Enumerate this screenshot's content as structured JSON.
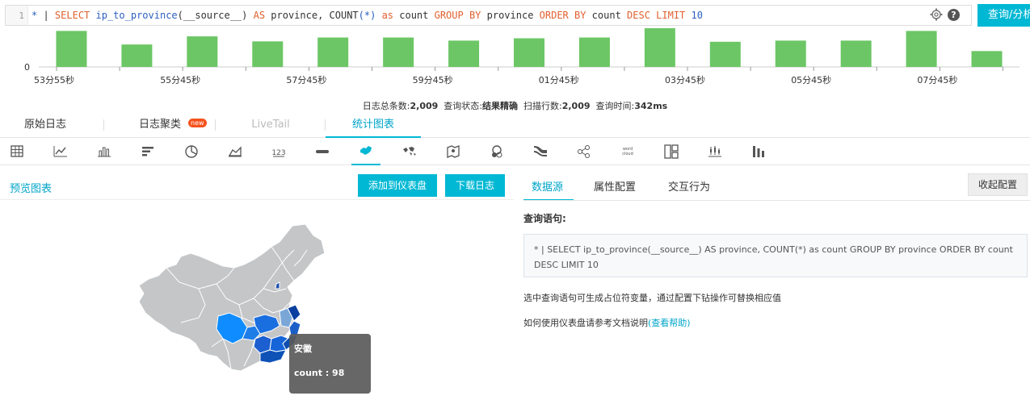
{
  "query": {
    "line_number": "1",
    "tokens": [
      {
        "t": "*",
        "c": "tk-star"
      },
      {
        "t": " | ",
        "c": "tk-punc"
      },
      {
        "t": "SELECT",
        "c": "tk-kw"
      },
      {
        "t": " ip_to_province",
        "c": "tk-blue"
      },
      {
        "t": "(",
        "c": "tk-punc"
      },
      {
        "t": "__source__",
        "c": "tk-id"
      },
      {
        "t": ")",
        "c": "tk-punc"
      },
      {
        "t": " AS",
        "c": "tk-kw"
      },
      {
        "t": " province, COUNT",
        "c": "tk-id"
      },
      {
        "t": "(*)",
        "c": "tk-blue"
      },
      {
        "t": " as",
        "c": "tk-kw"
      },
      {
        "t": " count ",
        "c": "tk-id"
      },
      {
        "t": "GROUP BY",
        "c": "tk-kw"
      },
      {
        "t": " province ",
        "c": "tk-id"
      },
      {
        "t": "ORDER BY",
        "c": "tk-kw"
      },
      {
        "t": " count ",
        "c": "tk-id"
      },
      {
        "t": "DESC LIMIT",
        "c": "tk-kw"
      },
      {
        "t": " 10",
        "c": "tk-blue"
      }
    ],
    "search_button": "查询/分析"
  },
  "histogram": {
    "y_zero_label": "0",
    "bar_color": "#6cc665",
    "time_labels": [
      "53分55秒",
      "55分45秒",
      "57分45秒",
      "59分45秒",
      "01分45秒",
      "03分45秒",
      "05分45秒",
      "07分45秒"
    ],
    "bars": [
      0.93,
      0.58,
      0.79,
      0.66,
      0.76,
      0.76,
      0.68,
      0.74,
      0.76,
      1.0,
      0.65,
      0.68,
      0.68,
      0.93,
      0.41
    ]
  },
  "stats": {
    "total_label": "日志总条数:",
    "total_value": "2,009",
    "status_label": "查询状态:",
    "status_value": "结果精确",
    "scanned_label": "扫描行数:",
    "scanned_value": "2,009",
    "time_label": "查询时间:",
    "time_value": "342ms"
  },
  "main_tabs": {
    "raw_logs": "原始日志",
    "log_cluster": "日志聚类",
    "new_badge": "new",
    "livetail": "LiveTail",
    "charts": "统计图表"
  },
  "chart_types": [
    "table",
    "line",
    "bar",
    "horizontal-bar",
    "pie",
    "area",
    "single-value",
    "progress-bar",
    "map",
    "world-map",
    "amap",
    "flow",
    "sankey",
    "force",
    "word-cloud",
    "matrix-tree",
    "candlestick",
    "column"
  ],
  "active_chart_type": "map",
  "preview": {
    "title": "预览图表",
    "add_dashboard": "添加到仪表盘",
    "download_logs": "下载日志"
  },
  "map": {
    "tooltip_province": "安徽",
    "tooltip_count": "count : 98",
    "base_color": "#c4c6c8",
    "scale_colors": [
      "#00a2ff",
      "#1a6fe0",
      "#0a3f9f",
      "#7aa7d8"
    ]
  },
  "right_panel": {
    "tabs": [
      "数据源",
      "属性配置",
      "交互行为"
    ],
    "collapse": "收起配置",
    "query_label": "查询语句:",
    "query_text": "* | SELECT ip_to_province(__source__) AS province, COUNT(*) as count GROUP BY province ORDER BY count DESC LIMIT 10",
    "hint_variables": "选中查询语句可生成占位符变量，通过配置下钻操作可替换相应值",
    "hint_docs_prefix": "如何使用仪表盘请参考文档说明",
    "hint_docs_link": "(查看帮助)"
  }
}
